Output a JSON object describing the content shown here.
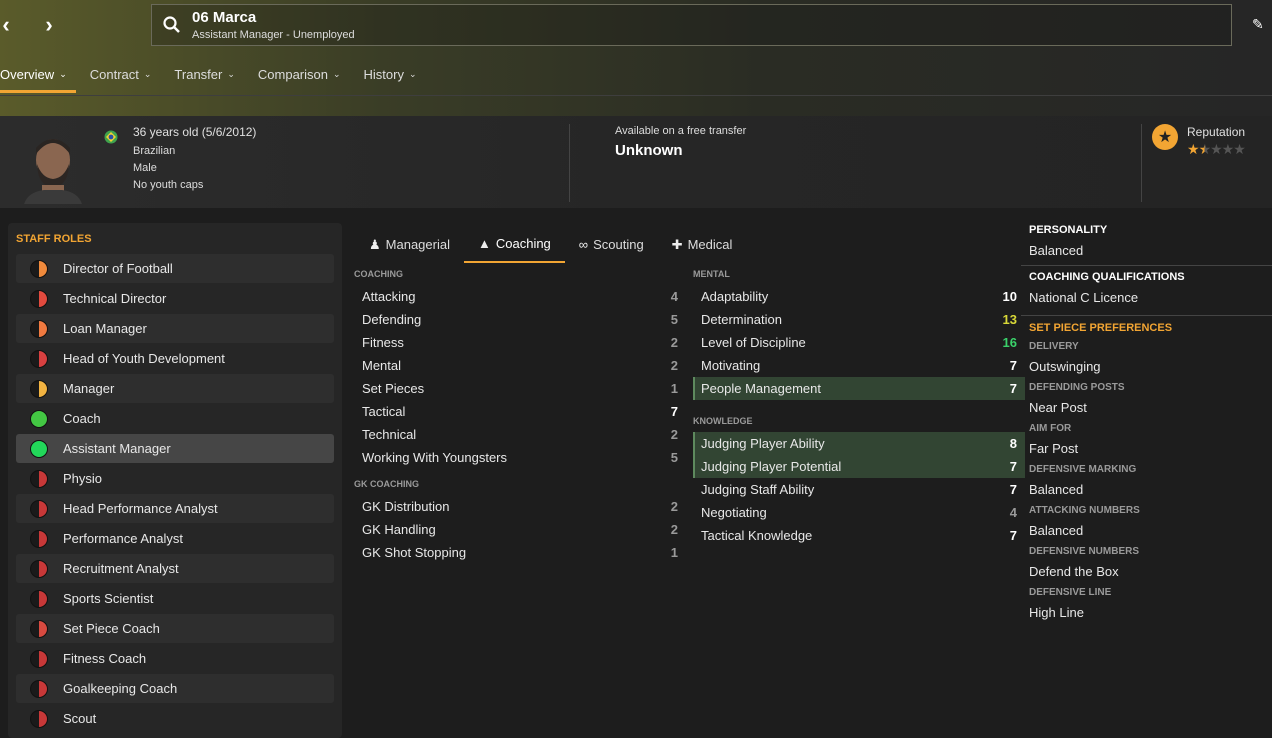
{
  "header": {
    "name": "06 Marca",
    "subtitle": "Assistant Manager - Unemployed"
  },
  "tabs": [
    {
      "label": "Overview"
    },
    {
      "label": "Contract"
    },
    {
      "label": "Transfer"
    },
    {
      "label": "Comparison"
    },
    {
      "label": "History"
    }
  ],
  "profile": {
    "age": "36 years old (5/6/2012)",
    "nationality": "Brazilian",
    "gender": "Male",
    "caps": "No youth caps",
    "availability_label": "Available on a free transfer",
    "availability_value": "Unknown",
    "reputation_label": "Reputation",
    "reputation_stars": 1.5
  },
  "staff_roles": {
    "title": "STAFF ROLES",
    "items": [
      {
        "label": "Director of Football",
        "color": "#f08a3c"
      },
      {
        "label": "Technical Director",
        "color": "#e24a3e"
      },
      {
        "label": "Loan Manager",
        "color": "#f07a40"
      },
      {
        "label": "Head of Youth Development",
        "color": "#d84040"
      },
      {
        "label": "Manager",
        "color": "#f2b341"
      },
      {
        "label": "Coach",
        "color": "#43c743"
      },
      {
        "label": "Assistant Manager",
        "color": "#22d85a"
      },
      {
        "label": "Physio",
        "color": "#c83838"
      },
      {
        "label": "Head Performance Analyst",
        "color": "#c83838"
      },
      {
        "label": "Performance Analyst",
        "color": "#c83838"
      },
      {
        "label": "Recruitment Analyst",
        "color": "#c83838"
      },
      {
        "label": "Sports Scientist",
        "color": "#c83838"
      },
      {
        "label": "Set Piece Coach",
        "color": "#d84a40"
      },
      {
        "label": "Fitness Coach",
        "color": "#c83838"
      },
      {
        "label": "Goalkeeping Coach",
        "color": "#c83838"
      },
      {
        "label": "Scout",
        "color": "#c83838"
      }
    ]
  },
  "sub_tabs": [
    {
      "label": "Managerial",
      "icon": "♟"
    },
    {
      "label": "Coaching",
      "icon": "▲"
    },
    {
      "label": "Scouting",
      "icon": "∞"
    },
    {
      "label": "Medical",
      "icon": "✚"
    }
  ],
  "coaching": {
    "title": "COACHING",
    "items": [
      {
        "label": "Attacking",
        "value": "4"
      },
      {
        "label": "Defending",
        "value": "5"
      },
      {
        "label": "Fitness",
        "value": "2"
      },
      {
        "label": "Mental",
        "value": "2"
      },
      {
        "label": "Set Pieces",
        "value": "1"
      },
      {
        "label": "Tactical",
        "value": "7"
      },
      {
        "label": "Technical",
        "value": "2"
      },
      {
        "label": "Working With Youngsters",
        "value": "5"
      }
    ]
  },
  "gk_coaching": {
    "title": "GK COACHING",
    "items": [
      {
        "label": "GK Distribution",
        "value": "2"
      },
      {
        "label": "GK Handling",
        "value": "2"
      },
      {
        "label": "GK Shot Stopping",
        "value": "1"
      }
    ]
  },
  "mental": {
    "title": "MENTAL",
    "items": [
      {
        "label": "Adaptability",
        "value": "10",
        "color": "#ffffff"
      },
      {
        "label": "Determination",
        "value": "13",
        "color": "#d8d838"
      },
      {
        "label": "Level of Discipline",
        "value": "16",
        "color": "#3ad16a"
      },
      {
        "label": "Motivating",
        "value": "7",
        "color": "#ffffff"
      },
      {
        "label": "People Management",
        "value": "7",
        "color": "#ffffff",
        "hl": true
      }
    ]
  },
  "knowledge": {
    "title": "KNOWLEDGE",
    "items": [
      {
        "label": "Judging Player Ability",
        "value": "8",
        "color": "#ffffff",
        "hl": true
      },
      {
        "label": "Judging Player Potential",
        "value": "7",
        "color": "#ffffff",
        "hl": true
      },
      {
        "label": "Judging Staff Ability",
        "value": "7",
        "color": "#ffffff"
      },
      {
        "label": "Negotiating",
        "value": "4",
        "color": "#9a9a9a"
      },
      {
        "label": "Tactical Knowledge",
        "value": "7",
        "color": "#ffffff"
      }
    ]
  },
  "personality": {
    "title": "PERSONALITY",
    "value": "Balanced"
  },
  "qualifications": {
    "title": "COACHING QUALIFICATIONS",
    "value": "National C Licence"
  },
  "set_piece": {
    "title": "SET PIECE PREFERENCES",
    "items": [
      {
        "label": "DELIVERY",
        "value": "Outswinging"
      },
      {
        "label": "DEFENDING POSTS",
        "value": "Near Post"
      },
      {
        "label": "AIM FOR",
        "value": "Far Post"
      },
      {
        "label": "DEFENSIVE MARKING",
        "value": "Balanced"
      },
      {
        "label": "ATTACKING NUMBERS",
        "value": "Balanced"
      },
      {
        "label": "DEFENSIVE NUMBERS",
        "value": "Defend the Box"
      },
      {
        "label": "DEFENSIVE LINE",
        "value": "High Line"
      }
    ]
  }
}
